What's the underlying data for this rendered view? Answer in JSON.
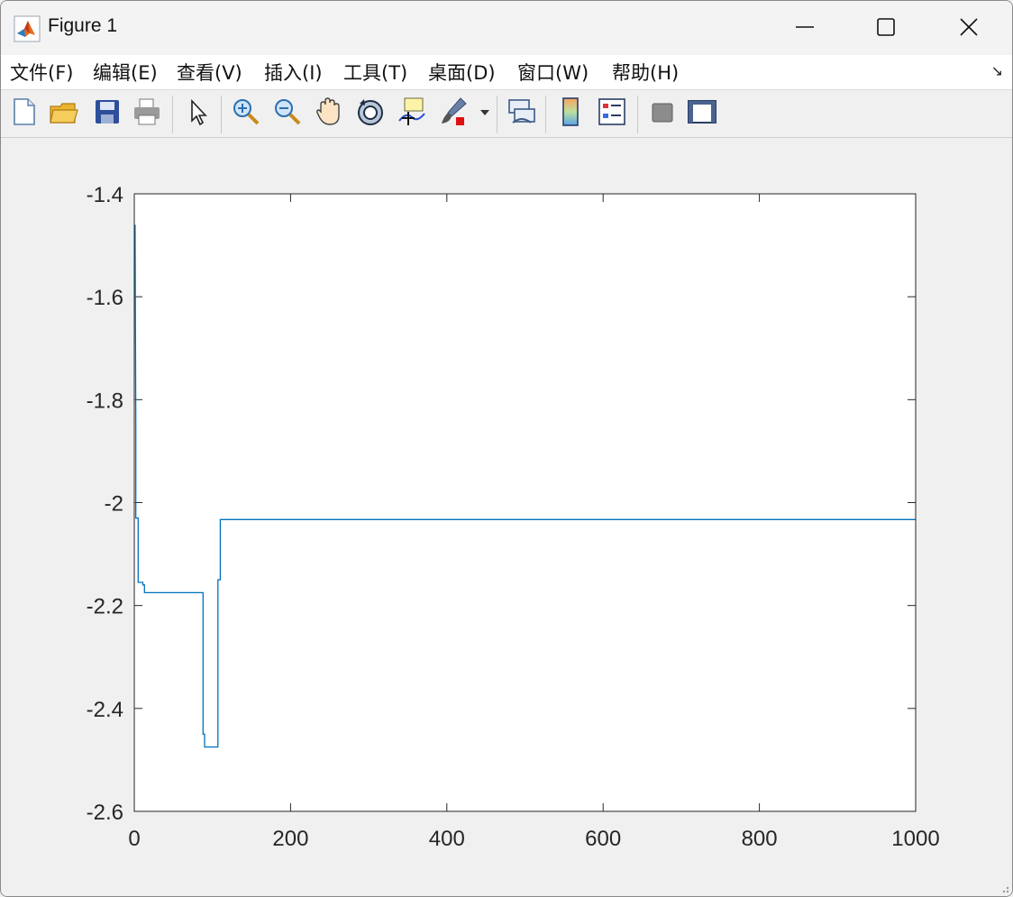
{
  "window": {
    "title": "Figure 1",
    "minimize_icon": "minimize-icon",
    "maximize_icon": "maximize-icon",
    "close_icon": "close-icon"
  },
  "menu": {
    "items": [
      {
        "label": "文件(F)"
      },
      {
        "label": "编辑(E)"
      },
      {
        "label": "查看(V)"
      },
      {
        "label": "插入(I)"
      },
      {
        "label": "工具(T)"
      },
      {
        "label": "桌面(D)"
      },
      {
        "label": "窗口(W)"
      },
      {
        "label": "帮助(H)"
      }
    ],
    "dock_arrow": "↘"
  },
  "toolbar": {
    "buttons": [
      "new-figure-icon",
      "open-file-icon",
      "save-icon",
      "print-icon",
      "select-arrow-icon",
      "zoom-in-icon",
      "zoom-out-icon",
      "pan-hand-icon",
      "rotate-3d-icon",
      "data-cursor-icon",
      "brush-icon",
      "brush-dropdown-icon",
      "link-plot-icon",
      "colorbar-icon",
      "legend-icon",
      "hide-plot-tools-icon",
      "show-plot-tools-icon"
    ]
  },
  "colors": {
    "line": "#0072bd",
    "axes": "#262626",
    "background": "#f0f0f0"
  },
  "chart_data": {
    "type": "line",
    "xlim": [
      0,
      1000
    ],
    "ylim": [
      -2.6,
      -1.4
    ],
    "xticks": [
      0,
      200,
      400,
      600,
      800,
      1000
    ],
    "yticks": [
      -1.4,
      -1.6,
      -1.8,
      -2.0,
      -2.2,
      -2.4,
      -2.6
    ],
    "xtick_labels": [
      "0",
      "200",
      "400",
      "600",
      "800",
      "1000"
    ],
    "ytick_labels": [
      "-1.4",
      "-1.6",
      "-1.8",
      "-2",
      "-2.2",
      "-2.4",
      "-2.6"
    ],
    "grid": false,
    "series": [
      {
        "x": [
          1,
          2,
          2,
          5,
          5,
          11,
          11,
          13,
          13,
          88,
          88,
          90,
          90,
          107,
          107,
          110,
          110,
          1000
        ],
        "y": [
          -1.46,
          -1.85,
          -2.03,
          -2.03,
          -2.155,
          -2.155,
          -2.16,
          -2.16,
          -2.175,
          -2.175,
          -2.45,
          -2.45,
          -2.475,
          -2.475,
          -2.15,
          -2.15,
          -2.033,
          -2.033
        ]
      }
    ]
  }
}
